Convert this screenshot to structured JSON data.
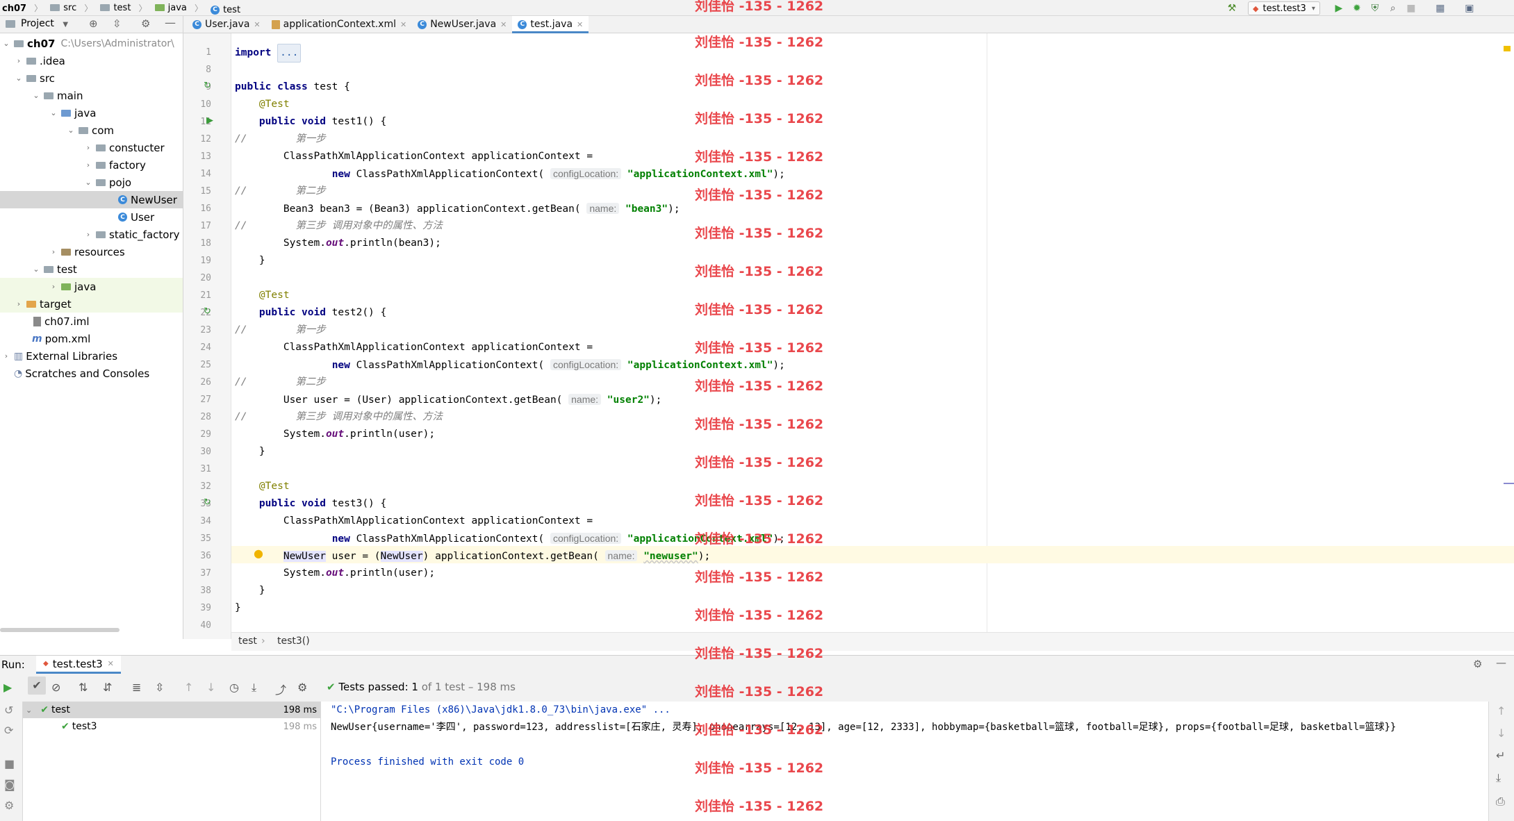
{
  "navbar": {
    "crumbs": [
      "ch07",
      "src",
      "test",
      "java",
      "test"
    ],
    "run_config": "test.test3"
  },
  "project_panel": {
    "title": "Project"
  },
  "tabs": [
    {
      "label": "User.java",
      "icon": "class"
    },
    {
      "label": "applicationContext.xml",
      "icon": "xml"
    },
    {
      "label": "NewUser.java",
      "icon": "class"
    },
    {
      "label": "test.java",
      "icon": "test-class",
      "active": true
    }
  ],
  "tree": [
    {
      "label": "ch07",
      "path": "C:\\Users\\Administrator\\",
      "icon": "module"
    },
    {
      "label": ".idea",
      "icon": "folder"
    },
    {
      "label": "src",
      "icon": "folder"
    },
    {
      "label": "main",
      "icon": "folder"
    },
    {
      "label": "java",
      "icon": "source-folder"
    },
    {
      "label": "com",
      "icon": "package"
    },
    {
      "label": "constucter",
      "icon": "package"
    },
    {
      "label": "factory",
      "icon": "package"
    },
    {
      "label": "pojo",
      "icon": "package"
    },
    {
      "label": "NewUser",
      "icon": "class"
    },
    {
      "label": "User",
      "icon": "class"
    },
    {
      "label": "static_factory",
      "icon": "package"
    },
    {
      "label": "resources",
      "icon": "resources-folder"
    },
    {
      "label": "test",
      "icon": "folder"
    },
    {
      "label": "java",
      "icon": "test-folder"
    },
    {
      "label": "target",
      "icon": "excluded-folder"
    },
    {
      "label": "ch07.iml",
      "icon": "iml-file"
    },
    {
      "label": "pom.xml",
      "icon": "maven-file"
    },
    {
      "label": "External Libraries",
      "icon": "library"
    },
    {
      "label": "Scratches and Consoles",
      "icon": "scratches"
    }
  ],
  "editor": {
    "line_numbers": [
      "1",
      "8",
      "9",
      "10",
      "11",
      "12",
      "13",
      "14",
      "15",
      "16",
      "17",
      "18",
      "19",
      "20",
      "21",
      "22",
      "23",
      "24",
      "25",
      "26",
      "27",
      "28",
      "29",
      "30",
      "31",
      "32",
      "33",
      "34",
      "35",
      "36",
      "37",
      "38",
      "39",
      "40"
    ],
    "breadcrumb": [
      "test",
      "test3()"
    ],
    "hints": {
      "config": "configLocation:",
      "name": "name:"
    },
    "strings": {
      "ctx": "\"applicationContext.xml\"",
      "bean3": "\"bean3\"",
      "user2": "\"user2\"",
      "newuser": "\"newuser\""
    },
    "comments": {
      "step1": "第一步",
      "step2": "第二步",
      "step3": "第三步 调用对象中的属性、方法"
    }
  },
  "watermark": "刘佳怡 -135 - 1262",
  "run": {
    "label": "Run:",
    "tab": "test.test3",
    "status_prefix": "Tests passed:",
    "status_count": "1",
    "status_suffix": "of 1 test – 198 ms",
    "tree": [
      {
        "label": "test",
        "time": "198 ms"
      },
      {
        "label": "test3",
        "time": "198 ms"
      }
    ],
    "console": [
      "\"C:\\Program Files (x86)\\Java\\jdk1.8.0_73\\bin\\java.exe\" ...",
      "NewUser{username='李四', password=123, addresslist=[石家庄, 灵寿], phonearrays=[12, 13], age=[12, 2333], hobbymap={basketball=篮球, football=足球}, props={football=足球, basketball=篮球}}",
      "",
      "Process finished with exit code 0"
    ]
  },
  "colors": {
    "accent": "#4a88c7",
    "keyword": "#000080",
    "string": "#008000",
    "annotation": "#808000",
    "comment": "#808080",
    "watermark": "#e8383d",
    "pass": "#3ea33e"
  }
}
